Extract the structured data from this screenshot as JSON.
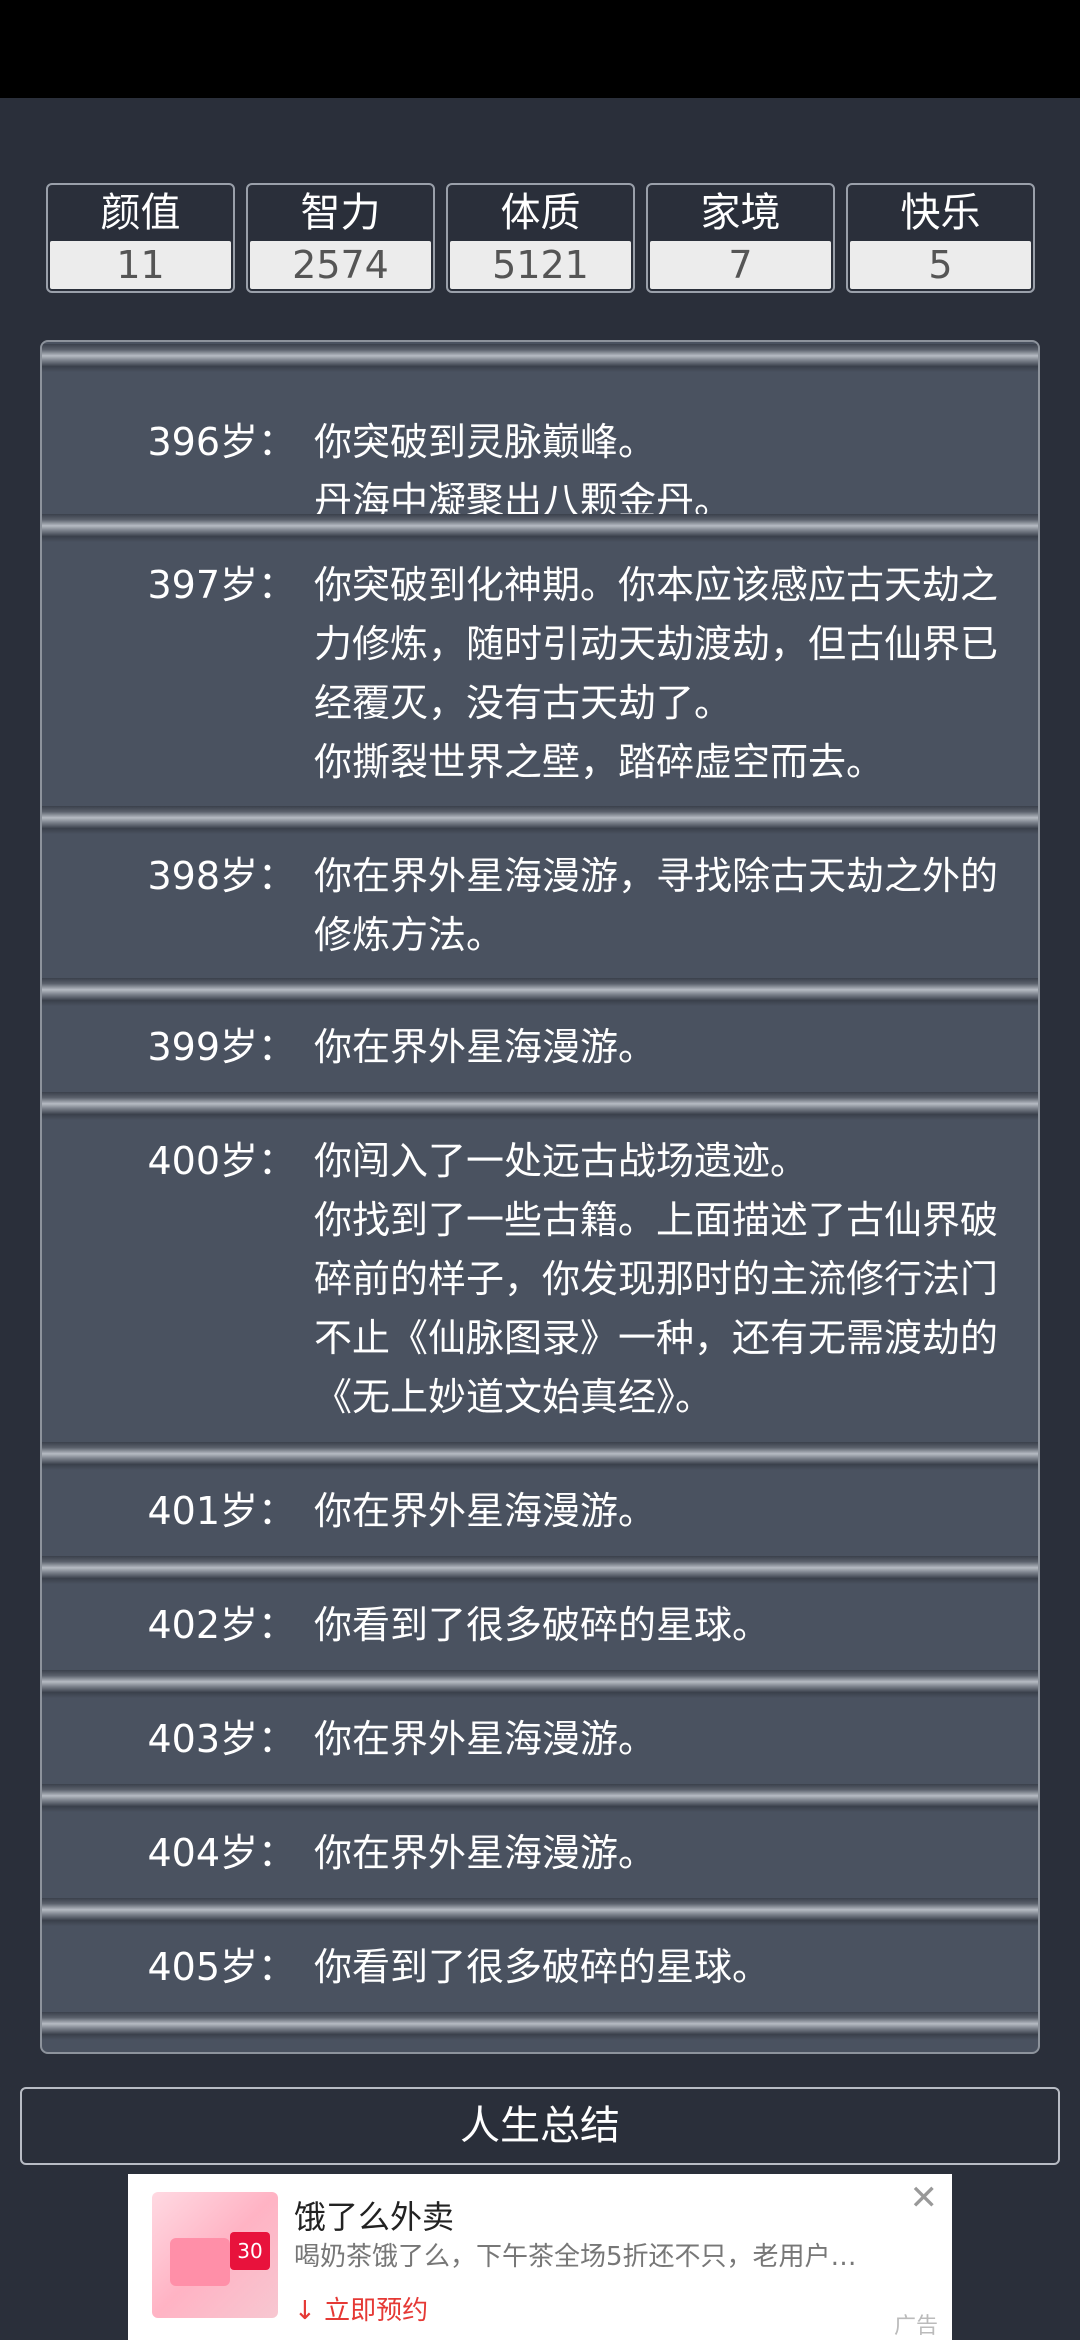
{
  "stats": [
    {
      "label": "颜值",
      "value": "11"
    },
    {
      "label": "智力",
      "value": "2574"
    },
    {
      "label": "体质",
      "value": "5121"
    },
    {
      "label": "家境",
      "value": "7"
    },
    {
      "label": "快乐",
      "value": "5"
    }
  ],
  "events": [
    {
      "age": "396岁：",
      "lines": [
        "你突破到灵脉巅峰。",
        "丹海中凝聚出八颗金丹。"
      ]
    },
    {
      "age": "397岁：",
      "lines": [
        "你突破到化神期。你本应该感应古天劫之",
        "力修炼，随时引动天劫渡劫，但古仙界已",
        "经覆灭，没有古天劫了。",
        "你撕裂世界之壁，踏碎虚空而去。"
      ]
    },
    {
      "age": "398岁：",
      "lines": [
        "你在界外星海漫游，寻找除古天劫之外的",
        "修炼方法。"
      ]
    },
    {
      "age": "399岁：",
      "lines": [
        "你在界外星海漫游。"
      ]
    },
    {
      "age": "400岁：",
      "lines": [
        "你闯入了一处远古战场遗迹。",
        "你找到了一些古籍。上面描述了古仙界破",
        "碎前的样子，你发现那时的主流修行法门",
        "不止《仙脉图录》一种，还有无需渡劫的",
        "《无上妙道文始真经》。"
      ]
    },
    {
      "age": "401岁：",
      "lines": [
        "你在界外星海漫游。"
      ]
    },
    {
      "age": "402岁：",
      "lines": [
        "你看到了很多破碎的星球。"
      ]
    },
    {
      "age": "403岁：",
      "lines": [
        "你在界外星海漫游。"
      ]
    },
    {
      "age": "404岁：",
      "lines": [
        "你在界外星海漫游。"
      ]
    },
    {
      "age": "405岁：",
      "lines": [
        "你看到了很多破碎的星球。"
      ]
    }
  ],
  "summary_button": {
    "label": "人生总结"
  },
  "ad": {
    "title": "饿了么外卖",
    "description": "喝奶茶饿了么，下午茶全场5折还不只，老用户…",
    "cta": "立即预约",
    "badge": "30",
    "label": "广告",
    "close_icon": "close-icon",
    "download_icon": "download-arrow-icon"
  }
}
